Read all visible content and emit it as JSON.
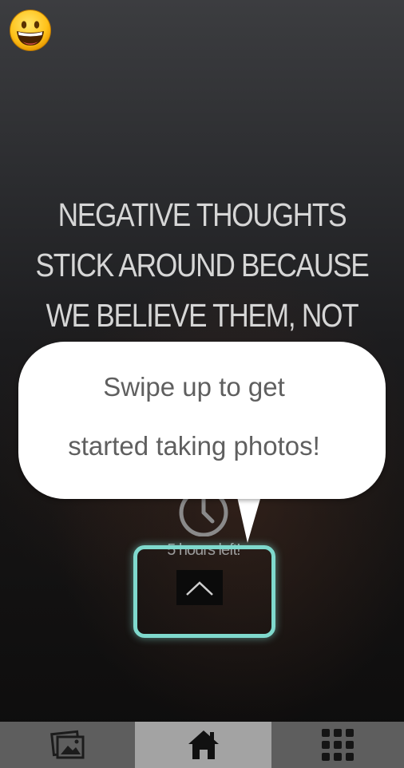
{
  "badge": {
    "icon": "grinning-face-emoji"
  },
  "quote": {
    "lines": [
      "NEGATIVE THOUGHTS",
      "STICK AROUND BECAUSE",
      "WE BELIEVE THEM, NOT"
    ]
  },
  "tooltip": {
    "line1": "Swipe up to get",
    "line2": "started taking photos!"
  },
  "timer": {
    "icon": "clock-icon",
    "label": "5 hours left!"
  },
  "swipe": {
    "icon": "chevron-up-icon"
  },
  "highlight_color": "#7fd9cd",
  "tabbar": {
    "active_tab": "home",
    "tabs": [
      {
        "id": "gallery",
        "icon": "gallery-icon"
      },
      {
        "id": "home",
        "icon": "home-icon"
      },
      {
        "id": "grid",
        "icon": "grid-icon"
      }
    ]
  }
}
